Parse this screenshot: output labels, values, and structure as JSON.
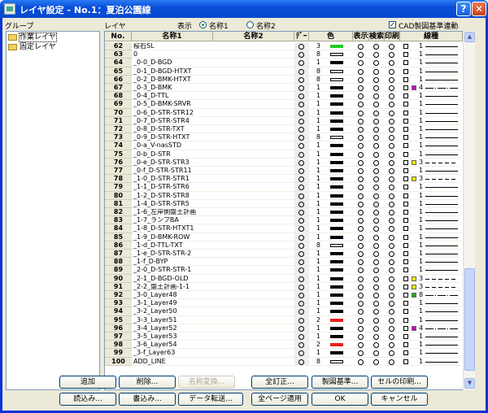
{
  "window": {
    "title": "レイヤ設定 - No.1：夏泊公園線",
    "help": "?",
    "close": "✕"
  },
  "labels": {
    "group": "グループ",
    "layer": "レイヤ",
    "display": "表示",
    "name1_radio": "名称1",
    "name2_radio": "名称2",
    "cad_check": "CAD製図基準連動"
  },
  "groups": [
    {
      "label": "作業レイヤ",
      "selected": true
    },
    {
      "label": "固定レイヤ",
      "selected": false
    }
  ],
  "columns": {
    "no": "No.",
    "name1": "名称1",
    "name2": "名称2",
    "data": "ﾃﾞｰﾀ",
    "color": "色",
    "show": "表示",
    "search": "検索",
    "print": "印刷",
    "linetype": "線種"
  },
  "rows": [
    {
      "no": "62",
      "name": "桜石SL",
      "cnt": "3",
      "col": "green",
      "lw": "1",
      "ln": "solid"
    },
    {
      "no": "63",
      "name": "0",
      "cnt": "8",
      "col": "w",
      "lw": "1",
      "ln": "solid"
    },
    {
      "no": "64",
      "name": "_0-0_D-BGD",
      "cnt": "1",
      "col": "b",
      "lw": "1",
      "ln": "solid"
    },
    {
      "no": "65",
      "name": "_0-1_D-BGD-HTXT",
      "cnt": "8",
      "col": "w",
      "lw": "1",
      "ln": "solid"
    },
    {
      "no": "66",
      "name": "_0-2_D-BMK-HTXT",
      "cnt": "8",
      "col": "w",
      "lw": "1",
      "ln": "solid"
    },
    {
      "no": "67",
      "name": "_0-3_D-BMK",
      "cnt": "1",
      "col": "b",
      "sw": "#cc00cc",
      "lw": "4",
      "ln": "dashdot"
    },
    {
      "no": "68",
      "name": "_0-4_D-TTL",
      "cnt": "1",
      "col": "b",
      "lw": "1",
      "ln": "solid"
    },
    {
      "no": "69",
      "name": "_0-5_D-BMK-SRVR",
      "cnt": "1",
      "col": "b",
      "lw": "1",
      "ln": "solid"
    },
    {
      "no": "70",
      "name": "_0-6_D-STR-STR12",
      "cnt": "1",
      "col": "b",
      "lw": "1",
      "ln": "solid"
    },
    {
      "no": "71",
      "name": "_0-7_D-STR-STR4",
      "cnt": "1",
      "col": "b",
      "lw": "1",
      "ln": "solid"
    },
    {
      "no": "72",
      "name": "_0-8_D-STR-TXT",
      "cnt": "1",
      "col": "b",
      "lw": "1",
      "ln": "solid"
    },
    {
      "no": "73",
      "name": "_0-9_D-STR-HTXT",
      "cnt": "8",
      "col": "w",
      "lw": "1",
      "ln": "solid"
    },
    {
      "no": "74",
      "name": "_0-a_V-nasSTD",
      "cnt": "1",
      "col": "b",
      "lw": "1",
      "ln": "solid"
    },
    {
      "no": "75",
      "name": "_0-b_D-STR",
      "cnt": "1",
      "col": "b",
      "lw": "1",
      "ln": "solid"
    },
    {
      "no": "76",
      "name": "_0-e_D-STR-STR3",
      "cnt": "1",
      "col": "b",
      "sw": "#eeee00",
      "lw": "3",
      "ln": "dash"
    },
    {
      "no": "77",
      "name": "_0-f_D-STR-STR11",
      "cnt": "1",
      "col": "b",
      "lw": "1",
      "ln": "solid"
    },
    {
      "no": "78",
      "name": "_1-0_D-STR-STR1",
      "cnt": "1",
      "col": "b",
      "sw": "#eeee00",
      "lw": "3",
      "ln": "dash"
    },
    {
      "no": "79",
      "name": "_1-1_D-STR-STR6",
      "cnt": "1",
      "col": "b",
      "lw": "1",
      "ln": "solid"
    },
    {
      "no": "80",
      "name": "_1-2_D-STR-STR8",
      "cnt": "1",
      "col": "b",
      "lw": "1",
      "ln": "solid"
    },
    {
      "no": "81",
      "name": "_1-4_D-STR-STR5",
      "cnt": "1",
      "col": "b",
      "lw": "1",
      "ln": "solid"
    },
    {
      "no": "82",
      "name": "_1-6_左岸側盛土計画",
      "cnt": "1",
      "col": "b",
      "lw": "1",
      "ln": "solid"
    },
    {
      "no": "83",
      "name": "_1-7_ランプBA",
      "cnt": "1",
      "col": "b",
      "lw": "1",
      "ln": "solid"
    },
    {
      "no": "84",
      "name": "_1-8_D-STR-HTXT1",
      "cnt": "1",
      "col": "b",
      "lw": "1",
      "ln": "solid"
    },
    {
      "no": "85",
      "name": "_1-9_D-BMK-ROW",
      "cnt": "1",
      "col": "b",
      "lw": "1",
      "ln": "solid"
    },
    {
      "no": "86",
      "name": "_1-d_D-TTL-TXT",
      "cnt": "8",
      "col": "w",
      "lw": "1",
      "ln": "solid"
    },
    {
      "no": "87",
      "name": "_1-e_D-STR-STR-2",
      "cnt": "1",
      "col": "b",
      "lw": "1",
      "ln": "solid"
    },
    {
      "no": "88",
      "name": "_1-f_D-BYP",
      "cnt": "1",
      "col": "b",
      "lw": "1",
      "ln": "solid"
    },
    {
      "no": "89",
      "name": "_2-0_D-STR-STR-1",
      "cnt": "1",
      "col": "b",
      "lw": "1",
      "ln": "solid"
    },
    {
      "no": "90",
      "name": "_2-1_D-BGD-OLD",
      "cnt": "1",
      "col": "b",
      "sw": "#eeee00",
      "lw": "3",
      "ln": "dash"
    },
    {
      "no": "91",
      "name": "_2-2_盛土計画-1-1",
      "cnt": "1",
      "col": "b",
      "sw": "#eeee00",
      "lw": "3",
      "ln": "dash"
    },
    {
      "no": "92",
      "name": "_3-0_Layer48",
      "cnt": "1",
      "col": "b",
      "sw": "#22aa22",
      "lw": "8",
      "ln": "dashdot"
    },
    {
      "no": "93",
      "name": "_3-1_Layer49",
      "cnt": "1",
      "col": "b",
      "lw": "1",
      "ln": "solid"
    },
    {
      "no": "94",
      "name": "_3-2_Layer50",
      "cnt": "1",
      "col": "b",
      "lw": "1",
      "ln": "solid"
    },
    {
      "no": "95",
      "name": "_3-3_Layer51",
      "cnt": "2",
      "col": "red",
      "lw": "1",
      "ln": "solid"
    },
    {
      "no": "96",
      "name": "_3-4_Layer52",
      "cnt": "1",
      "col": "b",
      "sw": "#cc00cc",
      "lw": "4",
      "ln": "dashdot"
    },
    {
      "no": "97",
      "name": "_3-5_Layer53",
      "cnt": "1",
      "col": "b",
      "lw": "1",
      "ln": "solid"
    },
    {
      "no": "98",
      "name": "_3-6_Layer54",
      "cnt": "2",
      "col": "red",
      "lw": "1",
      "ln": "solid"
    },
    {
      "no": "99",
      "name": "_3-f_Layer63",
      "cnt": "1",
      "col": "b",
      "lw": "1",
      "ln": "solid"
    },
    {
      "no": "100",
      "name": "ADD_LINE",
      "cnt": "8",
      "col": "w",
      "lw": "1",
      "ln": "solid"
    }
  ],
  "buttons_row1": [
    {
      "label": "追加",
      "enabled": true
    },
    {
      "label": "削除...",
      "enabled": true
    },
    {
      "label": "名称変換...",
      "enabled": false
    },
    {
      "label": "全訂正...",
      "enabled": true
    },
    {
      "label": "製図基準...",
      "enabled": true
    },
    {
      "label": "セルの印刷...",
      "enabled": true
    }
  ],
  "buttons_row2": [
    {
      "label": "読込み...",
      "enabled": true
    },
    {
      "label": "書込み...",
      "enabled": true
    },
    {
      "label": "データ転送...",
      "enabled": true
    },
    {
      "label": "全ページ適用",
      "enabled": true
    },
    {
      "label": "OK",
      "enabled": true
    },
    {
      "label": "キャンセル",
      "enabled": true
    }
  ]
}
